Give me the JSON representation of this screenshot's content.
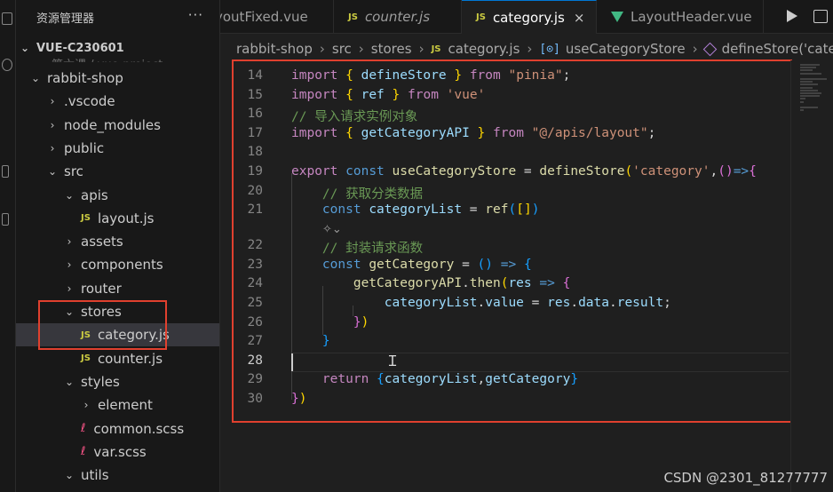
{
  "sidebar": {
    "title": "资源管理器",
    "more": "···",
    "project": "VUE-C230601",
    "ghost_path": "第六课 / vue-project",
    "tree": [
      {
        "label": "rabbit-shop",
        "type": "folder",
        "open": true,
        "depth": 1
      },
      {
        "label": ".vscode",
        "type": "folder",
        "open": false,
        "depth": 2
      },
      {
        "label": "node_modules",
        "type": "folder",
        "open": false,
        "depth": 2
      },
      {
        "label": "public",
        "type": "folder",
        "open": false,
        "depth": 2
      },
      {
        "label": "src",
        "type": "folder",
        "open": true,
        "depth": 2
      },
      {
        "label": "apis",
        "type": "folder",
        "open": true,
        "depth": 3
      },
      {
        "label": "layout.js",
        "type": "js",
        "depth": 4
      },
      {
        "label": "assets",
        "type": "folder",
        "open": false,
        "depth": 3
      },
      {
        "label": "components",
        "type": "folder",
        "open": false,
        "depth": 3
      },
      {
        "label": "router",
        "type": "folder",
        "open": false,
        "depth": 3
      },
      {
        "label": "stores",
        "type": "folder",
        "open": true,
        "depth": 3
      },
      {
        "label": "category.js",
        "type": "js",
        "depth": 4,
        "active": true
      },
      {
        "label": "counter.js",
        "type": "js",
        "depth": 4
      },
      {
        "label": "styles",
        "type": "folder",
        "open": true,
        "depth": 3
      },
      {
        "label": "element",
        "type": "folder",
        "open": false,
        "depth": 4
      },
      {
        "label": "common.scss",
        "type": "scss",
        "depth": 4
      },
      {
        "label": "var.scss",
        "type": "scss",
        "depth": 4
      },
      {
        "label": "utils",
        "type": "folder",
        "open": true,
        "depth": 3
      }
    ]
  },
  "tabs": [
    {
      "label": "youtFixed.vue",
      "icon": "vue"
    },
    {
      "label": "counter.js",
      "icon": "js"
    },
    {
      "label": "category.js",
      "icon": "js",
      "active": true,
      "close": "×"
    },
    {
      "label": "LayoutHeader.vue",
      "icon": "vue"
    }
  ],
  "js_badge": "JS",
  "breadcrumbs": {
    "items": [
      "rabbit-shop",
      "src",
      "stores",
      "category.js",
      "useCategoryStore",
      "defineStore('categ"
    ],
    "sep": "›",
    "bracket_icon": "[⊙]"
  },
  "editor": {
    "lines": [
      {
        "n": "14",
        "code": [
          [
            "tk-kw",
            "import"
          ],
          [
            "tk-op",
            " "
          ],
          [
            "tk-b1",
            "{"
          ],
          [
            "tk-op",
            " "
          ],
          [
            "tk-var",
            "defineStore"
          ],
          [
            "tk-op",
            " "
          ],
          [
            "tk-b1",
            "}"
          ],
          [
            "tk-op",
            " "
          ],
          [
            "tk-kw",
            "from"
          ],
          [
            "tk-op",
            " "
          ],
          [
            "tk-str",
            "\"pinia\""
          ],
          [
            "tk-op",
            ";"
          ]
        ]
      },
      {
        "n": "15",
        "code": [
          [
            "tk-kw",
            "import"
          ],
          [
            "tk-op",
            " "
          ],
          [
            "tk-b1",
            "{"
          ],
          [
            "tk-op",
            " "
          ],
          [
            "tk-var",
            "ref"
          ],
          [
            "tk-op",
            " "
          ],
          [
            "tk-b1",
            "}"
          ],
          [
            "tk-op",
            " "
          ],
          [
            "tk-kw",
            "from"
          ],
          [
            "tk-op",
            " "
          ],
          [
            "tk-str",
            "'vue'"
          ]
        ]
      },
      {
        "n": "16",
        "code": [
          [
            "tk-cm",
            "// 导入请求实例对象"
          ]
        ]
      },
      {
        "n": "17",
        "code": [
          [
            "tk-kw",
            "import"
          ],
          [
            "tk-op",
            " "
          ],
          [
            "tk-b1",
            "{"
          ],
          [
            "tk-op",
            " "
          ],
          [
            "tk-var",
            "getCategoryAPI"
          ],
          [
            "tk-op",
            " "
          ],
          [
            "tk-b1",
            "}"
          ],
          [
            "tk-op",
            " "
          ],
          [
            "tk-kw",
            "from"
          ],
          [
            "tk-op",
            " "
          ],
          [
            "tk-str",
            "\"@/apis/layout\""
          ],
          [
            "tk-op",
            ";"
          ]
        ]
      },
      {
        "n": "18",
        "code": []
      },
      {
        "n": "19",
        "code": [
          [
            "tk-kw",
            "export"
          ],
          [
            "tk-op",
            " "
          ],
          [
            "tk-kw2",
            "const"
          ],
          [
            "tk-op",
            " "
          ],
          [
            "tk-fn",
            "useCategoryStore"
          ],
          [
            "tk-op",
            " = "
          ],
          [
            "tk-fn",
            "defineStore"
          ],
          [
            "tk-b1",
            "("
          ],
          [
            "tk-str",
            "'category'"
          ],
          [
            "tk-op",
            ","
          ],
          [
            "tk-b2",
            "()"
          ],
          [
            "tk-kw2",
            "=>"
          ],
          [
            "tk-b2",
            "{"
          ]
        ]
      },
      {
        "n": "20",
        "code": [
          [
            "tk-op",
            "    "
          ],
          [
            "tk-cm",
            "// 获取分类数据"
          ]
        ]
      },
      {
        "n": "21",
        "code": [
          [
            "tk-op",
            "    "
          ],
          [
            "tk-kw2",
            "const"
          ],
          [
            "tk-op",
            " "
          ],
          [
            "tk-var",
            "categoryList"
          ],
          [
            "tk-op",
            " = "
          ],
          [
            "tk-fn",
            "ref"
          ],
          [
            "tk-b3",
            "("
          ],
          [
            "tk-b1",
            "[]"
          ],
          [
            "tk-b3",
            ")"
          ]
        ]
      },
      {
        "n": "22",
        "code": [
          [
            "tk-op",
            "    "
          ],
          [
            "tk-cm",
            "// 封装请求函数"
          ]
        ]
      },
      {
        "n": "23",
        "code": [
          [
            "tk-op",
            "    "
          ],
          [
            "tk-kw2",
            "const"
          ],
          [
            "tk-op",
            " "
          ],
          [
            "tk-fn",
            "getCategory"
          ],
          [
            "tk-op",
            " = "
          ],
          [
            "tk-b3",
            "()"
          ],
          [
            "tk-op",
            " "
          ],
          [
            "tk-kw2",
            "=>"
          ],
          [
            "tk-op",
            " "
          ],
          [
            "tk-b3",
            "{"
          ]
        ]
      },
      {
        "n": "24",
        "code": [
          [
            "tk-op",
            "        "
          ],
          [
            "tk-fn",
            "getCategoryAPI"
          ],
          [
            "tk-op",
            "."
          ],
          [
            "tk-fn",
            "then"
          ],
          [
            "tk-b1",
            "("
          ],
          [
            "tk-var",
            "res"
          ],
          [
            "tk-op",
            " "
          ],
          [
            "tk-kw2",
            "=>"
          ],
          [
            "tk-op",
            " "
          ],
          [
            "tk-b2",
            "{"
          ]
        ]
      },
      {
        "n": "25",
        "code": [
          [
            "tk-op",
            "            "
          ],
          [
            "tk-var",
            "categoryList"
          ],
          [
            "tk-op",
            "."
          ],
          [
            "tk-var",
            "value"
          ],
          [
            "tk-op",
            " = "
          ],
          [
            "tk-var",
            "res"
          ],
          [
            "tk-op",
            "."
          ],
          [
            "tk-var",
            "data"
          ],
          [
            "tk-op",
            "."
          ],
          [
            "tk-var",
            "result"
          ],
          [
            "tk-op",
            ";"
          ]
        ]
      },
      {
        "n": "26",
        "code": [
          [
            "tk-op",
            "        "
          ],
          [
            "tk-b2",
            "}"
          ],
          [
            "tk-b1",
            ")"
          ]
        ]
      },
      {
        "n": "27",
        "code": [
          [
            "tk-op",
            "    "
          ],
          [
            "tk-b3",
            "}"
          ]
        ]
      },
      {
        "n": "28",
        "code": [],
        "current": true
      },
      {
        "n": "29",
        "code": [
          [
            "tk-op",
            "    "
          ],
          [
            "tk-kw",
            "return"
          ],
          [
            "tk-op",
            " "
          ],
          [
            "tk-b3",
            "{"
          ],
          [
            "tk-var",
            "categoryList"
          ],
          [
            "tk-op",
            ","
          ],
          [
            "tk-var",
            "getCategory"
          ],
          [
            "tk-b3",
            "}"
          ]
        ]
      },
      {
        "n": "30",
        "code": [
          [
            "tk-b2",
            "}"
          ],
          [
            "tk-b1",
            ")"
          ]
        ]
      }
    ]
  },
  "watermark": "CSDN @2301_81277777",
  "colors": {
    "highlight_box": "#e0402e",
    "accent": "#0078d4"
  }
}
